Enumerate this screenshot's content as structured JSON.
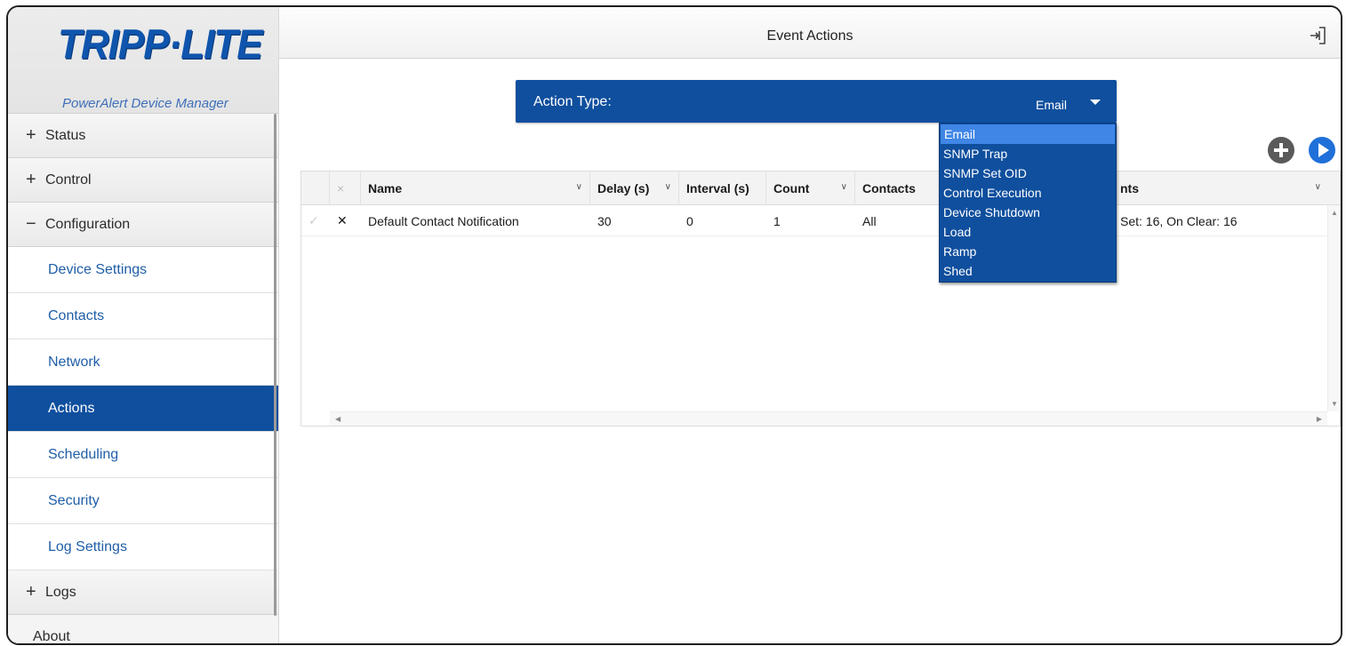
{
  "brand": {
    "logo_text": "TRIPP·LITE",
    "product_name": "PowerAlert Device Manager"
  },
  "sidebar": {
    "groups": [
      {
        "sign": "+",
        "label": "Status"
      },
      {
        "sign": "+",
        "label": "Control"
      },
      {
        "sign": "−",
        "label": "Configuration"
      }
    ],
    "items": [
      {
        "label": "Device Settings",
        "active": false
      },
      {
        "label": "Contacts",
        "active": false
      },
      {
        "label": "Network",
        "active": false
      },
      {
        "label": "Actions",
        "active": true
      },
      {
        "label": "Scheduling",
        "active": false
      },
      {
        "label": "Security",
        "active": false
      },
      {
        "label": "Log Settings",
        "active": false
      }
    ],
    "logs_group": {
      "sign": "+",
      "label": "Logs"
    },
    "about": "About"
  },
  "header": {
    "title": "Event Actions",
    "logout_icon": "logout-icon"
  },
  "action_type": {
    "label": "Action Type:",
    "selected": "Email",
    "options": [
      "Email",
      "SNMP Trap",
      "SNMP Set OID",
      "Control Execution",
      "Device Shutdown",
      "Load",
      "Ramp",
      "Shed"
    ]
  },
  "toolbar": {
    "add_icon": "plus-circle-icon",
    "run_icon": "play-circle-icon"
  },
  "table": {
    "columns": [
      "Name",
      "Delay (s)",
      "Interval (s)",
      "Count",
      "Contacts",
      "nts"
    ],
    "rows": [
      {
        "name": "Default Contact Notification",
        "delay": "30",
        "interval": "0",
        "count": "1",
        "contacts": "All",
        "events": "Set: 16, On Clear: 16"
      }
    ]
  },
  "colors": {
    "brand_blue": "#0f4f9e",
    "selected_option": "#3f86e6",
    "link_blue": "#1f5ea8"
  }
}
